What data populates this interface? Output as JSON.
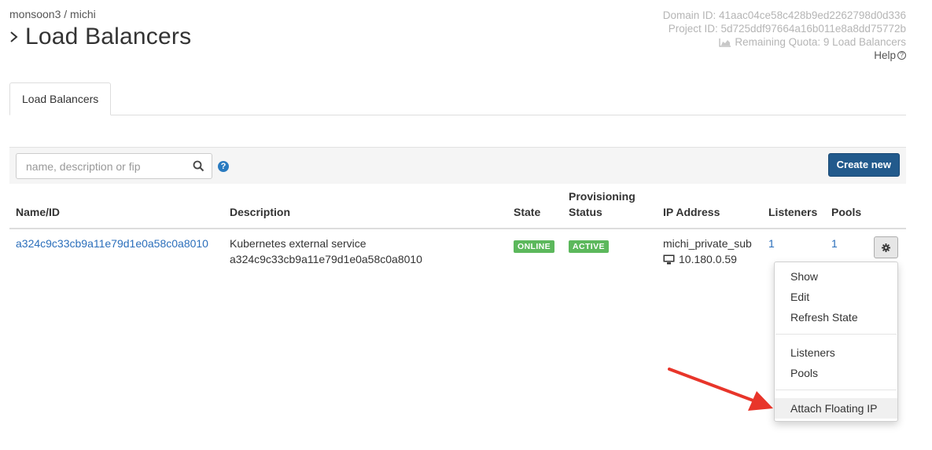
{
  "breadcrumb": "monsoon3 / michi",
  "page_title": "Load Balancers",
  "meta": {
    "domain_id": "Domain ID: 41aac04ce58c428b9ed2262798d0d336",
    "project_id": "Project ID: 5d725ddf97664a16b011e8a8dd75772b",
    "quota": "Remaining Quota: 9 Load Balancers",
    "help": "Help"
  },
  "tabs": [
    {
      "label": "Load Balancers"
    }
  ],
  "toolbar": {
    "search_placeholder": "name, description or fip",
    "help_icon_glyph": "?",
    "create_label": "Create new"
  },
  "table": {
    "headers": {
      "name": "Name/ID",
      "description": "Description",
      "state": "State",
      "provisioning_1": "Provisioning",
      "provisioning_2": "Status",
      "ip": "IP Address",
      "listeners": "Listeners",
      "pools": "Pools"
    },
    "rows": [
      {
        "name": "a324c9c33cb9a11e79d1e0a58c0a8010",
        "description_1": "Kubernetes external service",
        "description_2": "a324c9c33cb9a11e79d1e0a58c0a8010",
        "state": "ONLINE",
        "provisioning_status": "ACTIVE",
        "subnet": "michi_private_sub",
        "ip": "10.180.0.59",
        "listeners": "1",
        "pools": "1"
      }
    ]
  },
  "dropdown": {
    "items": [
      "Show",
      "Edit",
      "Refresh State",
      "Listeners",
      "Pools",
      "Attach Floating IP"
    ]
  },
  "colors": {
    "accent": "#225a8c",
    "link": "#2a6ebb",
    "status_green": "#5cb85c",
    "arrow": "#e8352a"
  }
}
